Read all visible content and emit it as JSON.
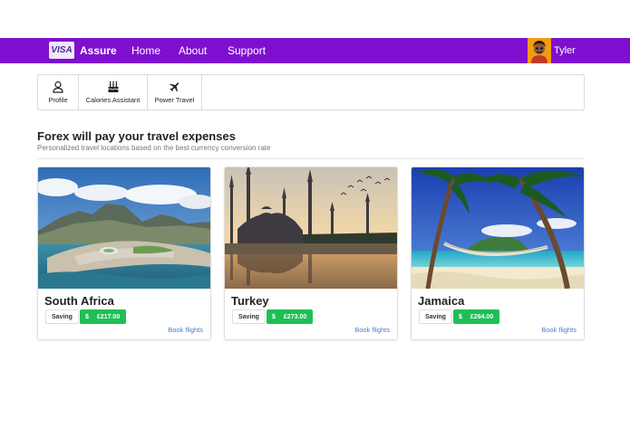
{
  "navbar": {
    "logo_text": "VISA",
    "brand_name": "Assure",
    "links": [
      "Home",
      "About",
      "Support"
    ],
    "user_name": "Tyler",
    "color": "#7f0fcf"
  },
  "menu": {
    "items": [
      {
        "label": "Profile",
        "icon": "person-icon"
      },
      {
        "label": "Calories Assistant",
        "icon": "cake-icon"
      },
      {
        "label": "Power Travel",
        "icon": "airplane-icon"
      }
    ]
  },
  "section": {
    "title": "Forex will pay your travel expenses",
    "subtitle": "Personalized travel locations based on the best currency conversion rate"
  },
  "cards": [
    {
      "country": "South Africa",
      "saving_label": "Saving",
      "currency_symbol": "$",
      "amount": "£217.00",
      "link": "Book flights"
    },
    {
      "country": "Turkey",
      "saving_label": "Saving",
      "currency_symbol": "$",
      "amount": "£273.00",
      "link": "Book flights"
    },
    {
      "country": "Jamaica",
      "saving_label": "Saving",
      "currency_symbol": "$",
      "amount": "£264.00",
      "link": "Book flights"
    }
  ],
  "colors": {
    "accent": "#7f0fcf",
    "saving_green": "#1fbf55",
    "link_blue": "#4a7ec9"
  }
}
